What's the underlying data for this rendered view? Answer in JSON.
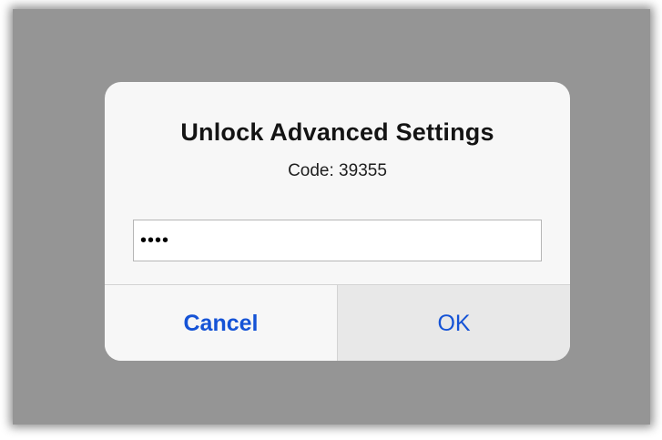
{
  "dialog": {
    "title": "Unlock Advanced Settings",
    "message": "Code: 39355",
    "input_value": "••••",
    "cancel_label": "Cancel",
    "ok_label": "OK"
  },
  "colors": {
    "backdrop": "#959595",
    "dialog_bg": "#f7f7f7",
    "button_text": "#1553d6",
    "ok_pressed_bg": "#e8e8e8"
  }
}
